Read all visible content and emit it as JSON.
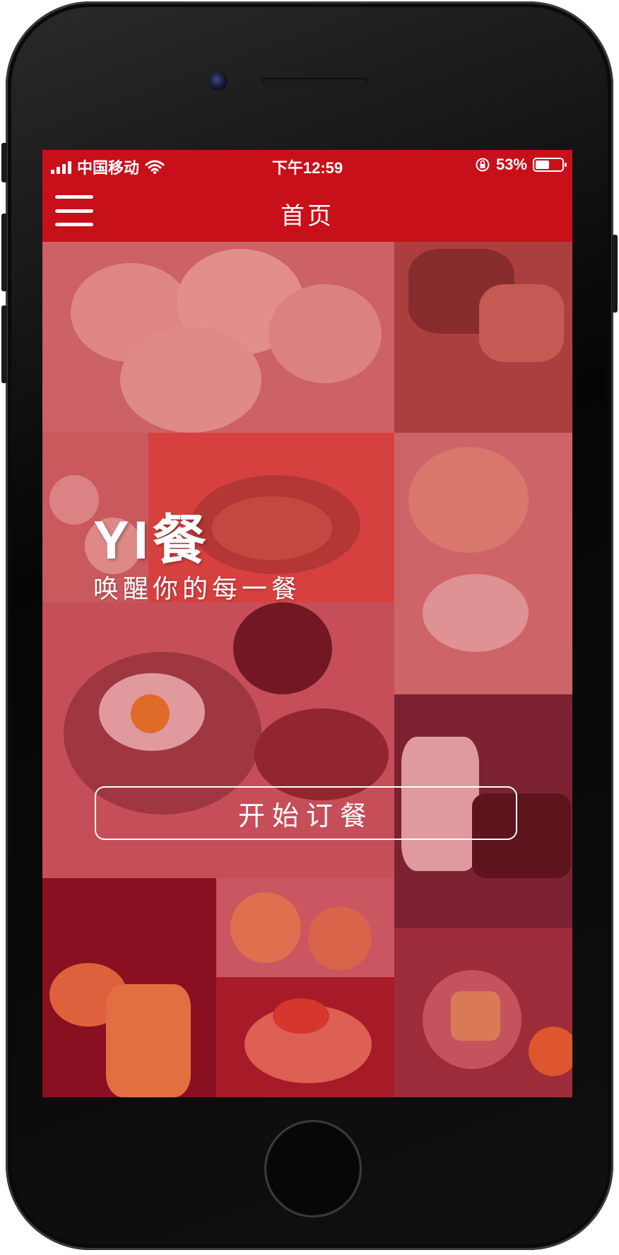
{
  "status_bar": {
    "carrier": "中国移动",
    "time": "下午12:59",
    "battery_percent": "53%",
    "battery_level": 0.53
  },
  "nav": {
    "title": "首页",
    "menu_icon": "hamburger-menu-icon"
  },
  "hero": {
    "title": "YI餐",
    "subtitle": "唤醒你的每一餐",
    "order_button_label": "开始订餐"
  },
  "colors": {
    "brand_red": "#c8101a",
    "overlay_red": "rgba(190,20,40,0.35)",
    "text_white": "#ffffff"
  }
}
